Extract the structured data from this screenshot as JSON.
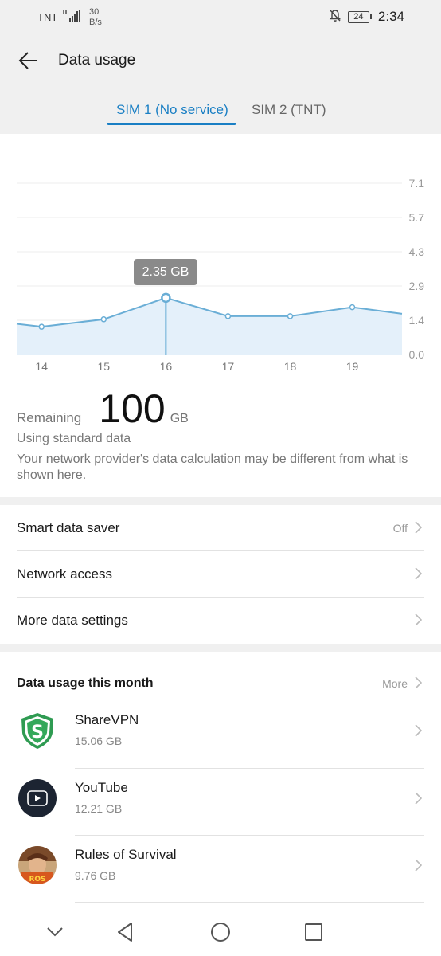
{
  "status_bar": {
    "carrier": "TNT",
    "speed_value": "30",
    "speed_unit": "B/s",
    "battery": "24",
    "time": "2:34"
  },
  "header": {
    "title": "Data usage",
    "tabs": [
      {
        "label": "SIM 1 (No service)",
        "active": true
      },
      {
        "label": "SIM 2 (TNT)",
        "active": false
      }
    ]
  },
  "chart_data": {
    "type": "area",
    "x": [
      "14",
      "15",
      "16",
      "17",
      "18",
      "19"
    ],
    "points": [
      {
        "x": 13.6,
        "y": 1.27
      },
      {
        "x": 14.0,
        "y": 1.15
      },
      {
        "x": 15.0,
        "y": 1.46
      },
      {
        "x": 16.0,
        "y": 2.35
      },
      {
        "x": 17.0,
        "y": 1.59
      },
      {
        "x": 18.0,
        "y": 1.59
      },
      {
        "x": 19.0,
        "y": 1.96
      },
      {
        "x": 19.8,
        "y": 1.69
      }
    ],
    "selected_x": 16,
    "tooltip": "2.35 GB",
    "yticks": [
      "7.1",
      "5.7",
      "4.3",
      "2.9",
      "1.4",
      "0.0"
    ],
    "ylim": [
      0,
      7.1
    ],
    "xlim": [
      13.6,
      19.8
    ],
    "grid": true,
    "line_color": "#6aaed6",
    "fill_color": "#e4f0fa"
  },
  "summary": {
    "remaining_label": "Remaining",
    "remaining_value": "100",
    "remaining_unit": "GB",
    "data_mode": "Using standard data",
    "disclaimer": "Your network provider's data calculation may be different from what is shown here."
  },
  "settings": [
    {
      "label": "Smart data saver",
      "value": "Off"
    },
    {
      "label": "Network access",
      "value": ""
    },
    {
      "label": "More data settings",
      "value": ""
    }
  ],
  "monthly": {
    "title": "Data usage this month",
    "more_label": "More",
    "apps": [
      {
        "name": "ShareVPN",
        "size": "15.06 GB",
        "icon": "sharevpn-icon"
      },
      {
        "name": "YouTube",
        "size": "12.21 GB",
        "icon": "youtube-icon"
      },
      {
        "name": "Rules of Survival",
        "size": "9.76 GB",
        "icon": "rules-of-survival-icon"
      }
    ]
  },
  "colors": {
    "accent": "#1a7fc4",
    "header_bg": "#f0f0f0"
  }
}
